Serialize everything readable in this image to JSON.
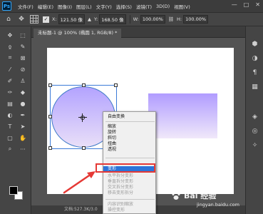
{
  "menubar": {
    "logo": "Ps",
    "items": [
      "文件(F)",
      "编辑(E)",
      "图像(I)",
      "图层(L)",
      "文字(Y)",
      "选择(S)",
      "滤镜(T)",
      "3D(D)",
      "视图(V)"
    ],
    "controls": [
      "—",
      "□",
      "✕"
    ]
  },
  "options": {
    "x_label": "X:",
    "x_value": "121.50 像",
    "y_label": "Y:",
    "y_value": "168.50 像",
    "w_label": "W:",
    "w_value": "100.00%",
    "h_label": "H:",
    "h_value": "100.00%"
  },
  "document": {
    "tab_title": "未标题-1 @ 100% (椭圆 1, RGB/8) *"
  },
  "context_menu": {
    "header": "自由变换",
    "group1": [
      "缩放",
      "旋转",
      "斜切",
      "扭曲",
      "透视"
    ],
    "selected": "变形",
    "group2": [
      "水平拆分变形",
      "垂直拆分变形",
      "交叉拆分变形",
      "移去变形拆分"
    ],
    "group3": [
      "内容识别缩放",
      "操控变形"
    ]
  },
  "status": {
    "text": "文档:527.3K/3.0"
  },
  "watermark": {
    "main": "Bai 经验",
    "sub": "jingyan.baidu.com"
  },
  "colors": {
    "highlight": "#e53935",
    "selection": "#2b74d9",
    "gradient_top": "#b09cff",
    "gradient_bottom": "#f0e8fa"
  },
  "icons": {
    "toolbar": [
      "move-icon",
      "marquee-icon",
      "lasso-icon",
      "quick-select-icon",
      "crop-icon",
      "frame-icon",
      "eyedropper-icon",
      "healing-icon",
      "brush-icon",
      "stamp-icon",
      "history-brush-icon",
      "eraser-icon",
      "gradient-icon",
      "blur-icon",
      "dodge-icon",
      "pen-icon",
      "type-icon",
      "path-select-icon",
      "shape-icon",
      "hand-icon",
      "zoom-icon",
      "more-icon"
    ],
    "right_panel": [
      "cube-icon",
      "adjust-icon",
      "paragraph-icon",
      "panel-icon",
      "layers-icon",
      "channels-icon",
      "paths-icon"
    ]
  }
}
